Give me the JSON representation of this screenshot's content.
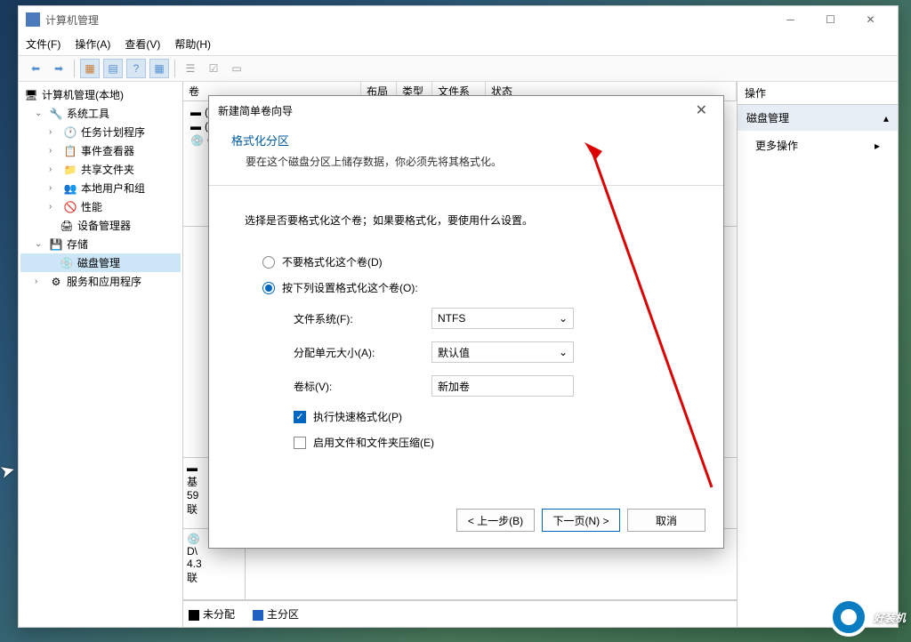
{
  "window": {
    "title": "计算机管理",
    "menu": {
      "file": "文件(F)",
      "action": "操作(A)",
      "view": "查看(V)",
      "help": "帮助(H)"
    }
  },
  "tree": {
    "root": "计算机管理(本地)",
    "system_tools": "系统工具",
    "task_scheduler": "任务计划程序",
    "event_viewer": "事件查看器",
    "shared_folders": "共享文件夹",
    "local_users": "本地用户和组",
    "performance": "性能",
    "device_manager": "设备管理器",
    "storage": "存储",
    "disk_management": "磁盘管理",
    "services": "服务和应用程序"
  },
  "vol_header": {
    "volume": "卷",
    "layout": "布局",
    "type": "类型",
    "filesystem": "文件系统",
    "status": "状态"
  },
  "vol_rows": {
    "r1": "(",
    "r2": "(",
    "r3": "C"
  },
  "disk_bottom": {
    "basic": "基",
    "size": "59",
    "online": "联",
    "dvd": "D\\",
    "dvd_size": "4.3",
    "dvd_status": "联"
  },
  "legend": {
    "unallocated": "未分配",
    "primary": "主分区"
  },
  "actions": {
    "header": "操作",
    "group": "磁盘管理",
    "more": "更多操作"
  },
  "wizard": {
    "title": "新建简单卷向导",
    "head_title": "格式化分区",
    "head_sub": "要在这个磁盘分区上储存数据，你必须先将其格式化。",
    "instruction": "选择是否要格式化这个卷；如果要格式化，要使用什么设置。",
    "radio_no_format": "不要格式化这个卷(D)",
    "radio_format": "按下列设置格式化这个卷(O):",
    "fs_label": "文件系统(F):",
    "fs_value": "NTFS",
    "alloc_label": "分配单元大小(A):",
    "alloc_value": "默认值",
    "vol_label_label": "卷标(V):",
    "vol_label_value": "新加卷",
    "quick_format": "执行快速格式化(P)",
    "compression": "启用文件和文件夹压缩(E)",
    "back_btn": "< 上一步(B)",
    "next_btn": "下一页(N) >",
    "cancel_btn": "取消"
  },
  "watermark": "好装机"
}
